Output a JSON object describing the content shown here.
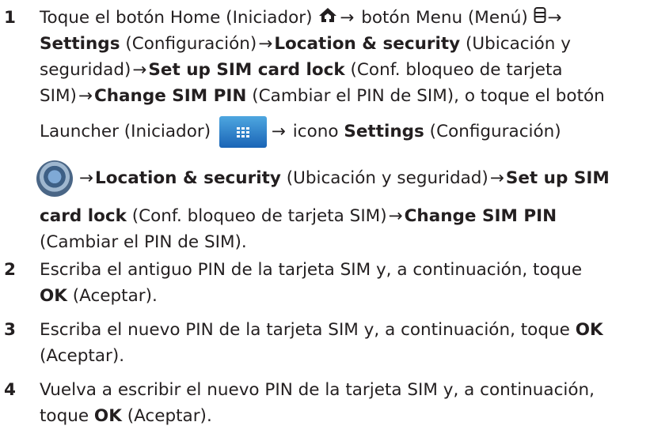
{
  "steps": [
    {
      "num": "1",
      "l1a": "Toque el botón Home (Iniciador) ",
      "arrow": "→",
      "l1b": " botón Menu (Menú) ",
      "l2a": "Settings",
      "l2b": " (Configuración)",
      "l2c": "Location & security",
      "l2d": " (Ubicación y",
      "l3a": "seguridad)",
      "l3b": "Set up SIM card lock",
      "l3c": " (Conf. bloqueo de tarjeta",
      "l4a": "SIM)",
      "l4b": "Change SIM PIN",
      "l4c": " (Cambiar el PIN de SIM), o toque el botón",
      "l5a": "Launcher (Iniciador) ",
      "l5b": " icono ",
      "l5c": "Settings",
      "l5d": " (Configuración)",
      "l6a": "Location & security",
      "l6b": " (Ubicación y seguridad)",
      "l6c": "Set up SIM",
      "l7a": "card lock",
      "l7b": " (Conf. bloqueo de tarjeta SIM)",
      "l7c": "Change SIM PIN",
      "l8a": "(Cambiar el PIN de SIM)."
    },
    {
      "num": "2",
      "l1": "Escriba el antiguo PIN de la tarjeta SIM y, a continuación, toque",
      "l2a": "OK",
      "l2b": " (Aceptar)."
    },
    {
      "num": "3",
      "l1a": "Escriba el nuevo PIN de la tarjeta SIM y, a continuación, toque ",
      "l1b": "OK",
      "l2": "(Aceptar)."
    },
    {
      "num": "4",
      "l1": "Vuelva a escribir el nuevo PIN de la tarjeta SIM y, a continuación,",
      "l2a": "toque ",
      "l2b": "OK",
      "l2c": " (Aceptar)."
    }
  ],
  "icons": {
    "home": "home-icon",
    "menu": "menu-icon",
    "launcher": "launcher-icon",
    "settings": "settings-icon"
  }
}
